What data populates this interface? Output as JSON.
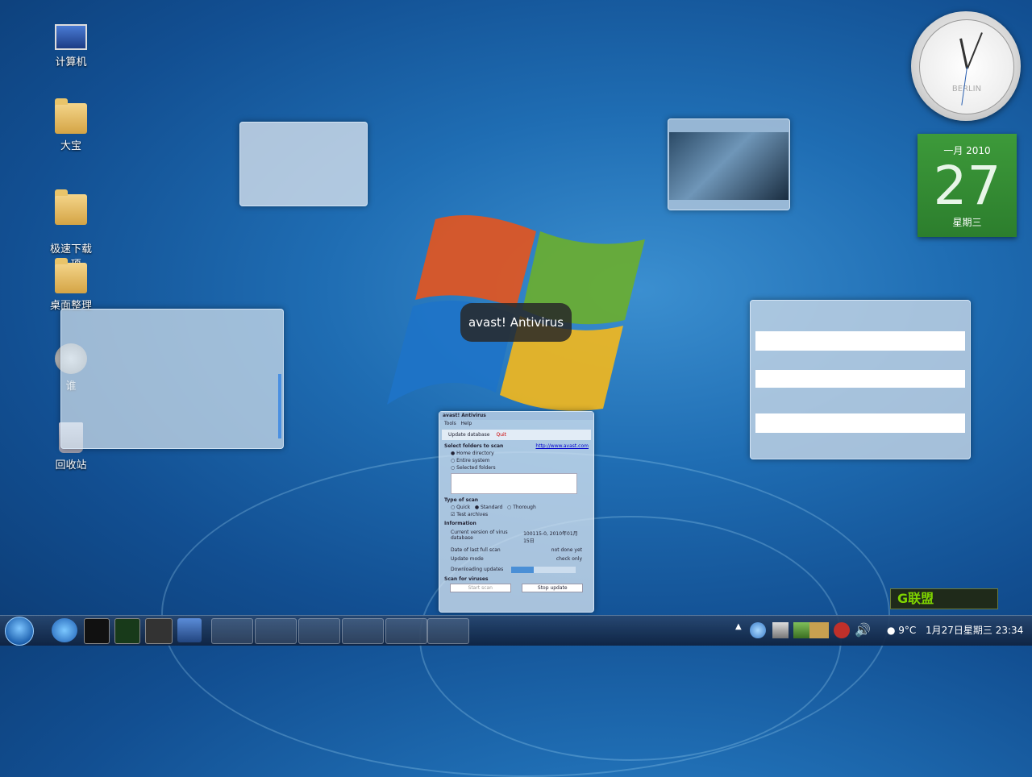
{
  "desktop_icons": [
    {
      "label": "计算机",
      "icon": "computer-icon"
    },
    {
      "label": "大宝",
      "icon": "user-folder-icon"
    },
    {
      "label": "极速下载\n2 项",
      "icon": "folder-icon"
    },
    {
      "label": "桌面整理",
      "icon": "folder-icon"
    },
    {
      "label": "谁",
      "icon": "app-icon"
    },
    {
      "label": "回收站",
      "icon": "recycle-bin-icon"
    }
  ],
  "switcher_tooltip": "avast! Antivirus",
  "avast": {
    "title": "avast! Antivirus",
    "menu": [
      "Tools",
      "Help"
    ],
    "toolbar": [
      "Update database",
      "Quit"
    ],
    "select_heading": "Select folders to scan",
    "link": "http://www.avast.com",
    "folder_options": [
      "Home directory",
      "Entire system",
      "Selected folders"
    ],
    "type_heading": "Type of scan",
    "type_options": [
      "Quick",
      "Standard",
      "Thorough"
    ],
    "test_archives": "Test archives",
    "info_heading": "Information",
    "info_rows": [
      {
        "k": "Current version of virus database",
        "v": "100115-0, 2010年01月15日"
      },
      {
        "k": "Date of last full scan",
        "v": "not done yet"
      },
      {
        "k": "Update mode",
        "v": "check only"
      }
    ],
    "downloading": "Downloading updates",
    "progress": 0.35,
    "scan_heading": "Scan for viruses",
    "buttons": [
      "Start scan",
      "Stop update"
    ]
  },
  "clock": {
    "city": "BERLIN"
  },
  "calendar": {
    "month": "一月 2010",
    "day": "27",
    "weekday": "星期三"
  },
  "tray": {
    "temp": "9°C",
    "datetime": "1月27日星期三 23:34",
    "badge": "G联盟"
  }
}
